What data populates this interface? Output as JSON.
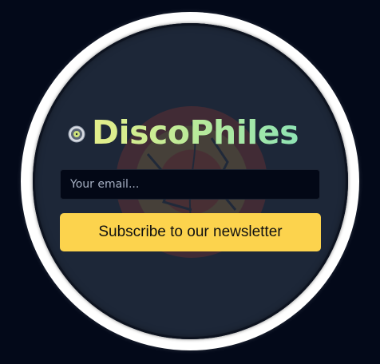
{
  "brand": {
    "name": "DiscoPhiles",
    "icon": "vinyl-record-icon"
  },
  "newsletter": {
    "email_placeholder": "Your email...",
    "email_value": "",
    "subscribe_label": "Subscribe to our newsletter"
  },
  "colors": {
    "page_background": "#030919",
    "disc_background": "#1d2738",
    "ring": "#ffffff",
    "accent_button": "#fcd34d",
    "title_gradient_start": "#e4ee8a",
    "title_gradient_end": "#8fe3b4"
  }
}
